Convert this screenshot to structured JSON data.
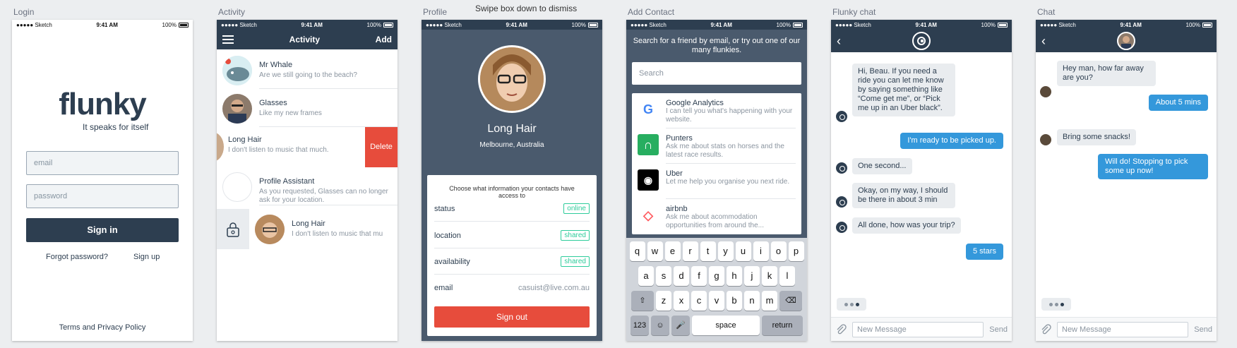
{
  "board": {
    "labels": [
      "Login",
      "Activity",
      "Profile",
      "Add Contact",
      "Flunky chat",
      "Chat"
    ],
    "note": "Swipe box down to dismiss"
  },
  "status_bar": {
    "carrier": "●●●●● Sketch",
    "time": "9:41 AM",
    "battery": "100%"
  },
  "login": {
    "brand": "flunky",
    "tagline": "It speaks for itself",
    "email_placeholder": "email",
    "password_placeholder": "password",
    "signin_label": "Sign in",
    "forgot_label": "Forgot password?",
    "signup_label": "Sign up",
    "terms_label": "Terms and Privacy Policy"
  },
  "activity": {
    "title": "Activity",
    "add_label": "Add",
    "rows": [
      {
        "name": "Mr Whale",
        "sub": "Are we still going to the beach?"
      },
      {
        "name": "Glasses",
        "sub": "Like my new frames"
      },
      {
        "name": "Long Hair",
        "sub": "I don't listen to music that much."
      },
      {
        "name": "Profile Assistant",
        "sub": "As you requested, Glasses can no longer ask for your location."
      },
      {
        "name": "Long Hair",
        "sub": "I don't listen to music that mu"
      }
    ],
    "delete_label": "Delete"
  },
  "profile": {
    "name": "Long Hair",
    "location": "Melbourne, Australia",
    "share_heading": "Choose what information your contacts have access to",
    "fields": [
      {
        "label": "status",
        "value": "online"
      },
      {
        "label": "location",
        "value": "shared"
      },
      {
        "label": "availability",
        "value": "shared"
      },
      {
        "label": "email",
        "value": "casuist@live.com.au"
      }
    ],
    "signout_label": "Sign out"
  },
  "add_contact": {
    "intro": "Search for a friend by email, or try out one of our many flunkies.",
    "search_placeholder": "Search",
    "items": [
      {
        "name": "Google Analytics",
        "desc": "I can tell you what's happening with your website.",
        "icon": "google-icon",
        "color": "#4285f4"
      },
      {
        "name": "Punters",
        "desc": "Ask me about stats on horses and the latest race results.",
        "icon": "horseshoe-icon",
        "color": "#27ae60"
      },
      {
        "name": "Uber",
        "desc": "Let me help you organise you next ride.",
        "icon": "uber-icon",
        "color": "#000000"
      },
      {
        "name": "airbnb",
        "desc": "Ask me about acommodation opportunities from around the...",
        "icon": "airbnb-icon",
        "color": "#ff5a5f"
      }
    ],
    "keyboard": {
      "row1": [
        "q",
        "w",
        "e",
        "r",
        "t",
        "y",
        "u",
        "i",
        "o",
        "p"
      ],
      "row2": [
        "a",
        "s",
        "d",
        "f",
        "g",
        "h",
        "j",
        "k",
        "l"
      ],
      "row3": [
        "z",
        "x",
        "c",
        "v",
        "b",
        "n",
        "m"
      ],
      "shift": "⇧",
      "backspace": "⌫",
      "numbers": "123",
      "emoji": "☺",
      "mic": "🎤",
      "space": "space",
      "return": "return"
    }
  },
  "flunky_chat": {
    "messages": [
      {
        "from": "bot",
        "text": "Hi, Beau. If you need a ride you can let me know by saying something like “Come get me”, or “Pick me up in an Uber black”."
      },
      {
        "from": "me",
        "text": "I'm ready to be picked up."
      },
      {
        "from": "bot",
        "text": "One second..."
      },
      {
        "from": "bot",
        "text": "Okay, on my way, I should be there in about 3 min"
      },
      {
        "from": "bot",
        "text": "All done, how was your trip?"
      },
      {
        "from": "me",
        "text": "5 stars"
      }
    ],
    "input_placeholder": "New Message",
    "send_label": "Send"
  },
  "chat": {
    "messages": [
      {
        "from": "them",
        "text": "Hey man, how far away are you?"
      },
      {
        "from": "me",
        "text": "About 5 mins"
      },
      {
        "from": "them",
        "text": "Bring some snacks!"
      },
      {
        "from": "me",
        "text": "Will do! Stopping to pick some up now!"
      }
    ],
    "input_placeholder": "New Message",
    "send_label": "Send"
  },
  "colors": {
    "primary": "#2d3e50",
    "accent": "#3498db",
    "danger": "#e74c3c",
    "success": "#2ecc9b"
  }
}
